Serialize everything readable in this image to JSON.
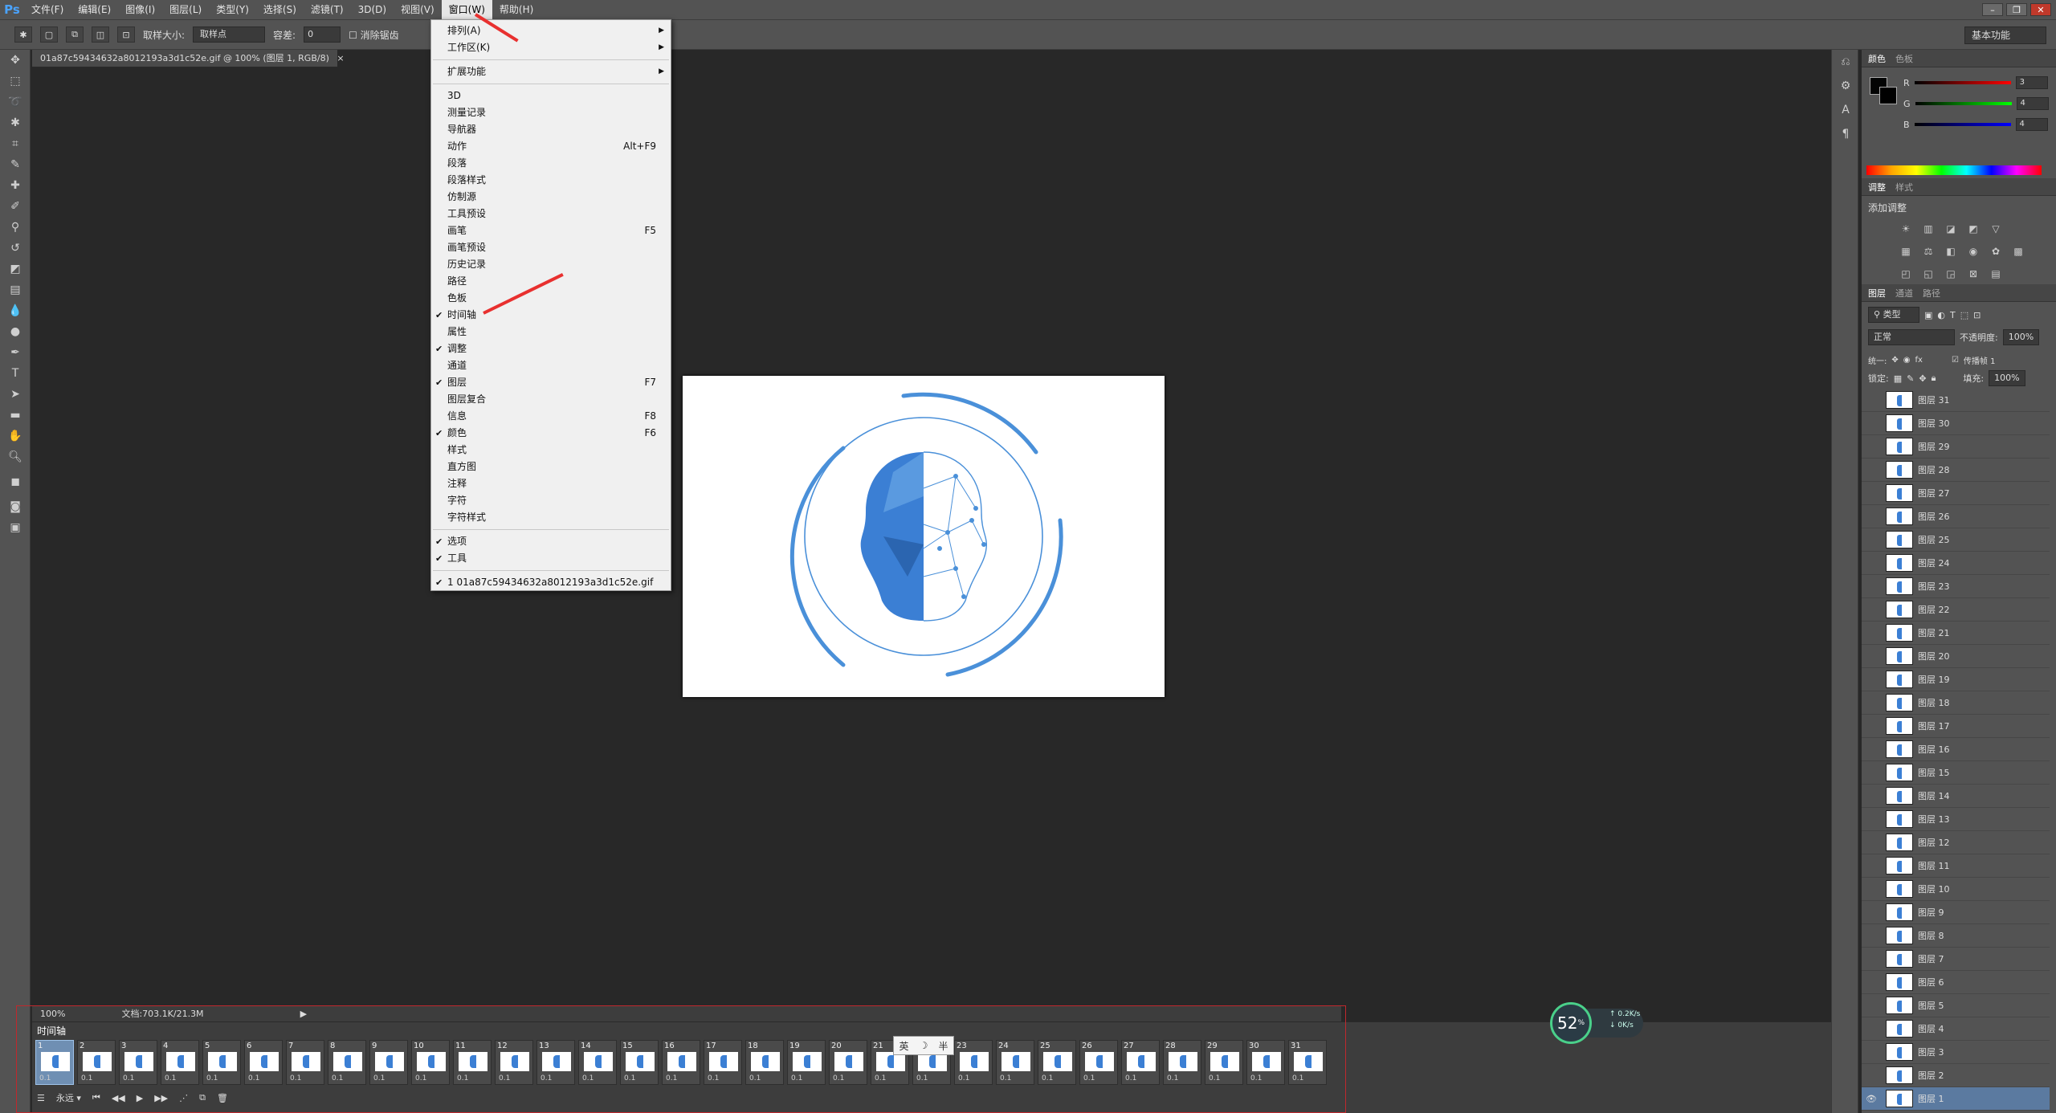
{
  "app": {
    "logo": "Ps"
  },
  "menubar": {
    "items": [
      "文件(F)",
      "编辑(E)",
      "图像(I)",
      "图层(L)",
      "类型(Y)",
      "选择(S)",
      "滤镜(T)",
      "3D(D)",
      "视图(V)",
      "窗口(W)",
      "帮助(H)"
    ],
    "active_index": 9
  },
  "optionsbar": {
    "sample_size_label": "取样大小:",
    "sample_size_value": "取样点",
    "tolerance_label": "容差:",
    "tolerance_value": "0",
    "antialias_label": "消除锯齿",
    "workspace": "基本功能"
  },
  "document": {
    "tab_title": "01a87c59434632a8012193a3d1c52e.gif @ 100% (图层 1, RGB/8)",
    "tab_close": "×"
  },
  "window_menu": {
    "groups": [
      [
        {
          "label": "排列(A)",
          "submenu": true
        },
        {
          "label": "工作区(K)",
          "submenu": true
        }
      ],
      [
        {
          "label": "扩展功能",
          "submenu": true
        }
      ],
      [
        {
          "label": "3D"
        },
        {
          "label": "测量记录"
        },
        {
          "label": "导航器"
        },
        {
          "label": "动作",
          "shortcut": "Alt+F9"
        },
        {
          "label": "段落"
        },
        {
          "label": "段落样式"
        },
        {
          "label": "仿制源"
        },
        {
          "label": "工具预设"
        },
        {
          "label": "画笔",
          "shortcut": "F5"
        },
        {
          "label": "画笔预设"
        },
        {
          "label": "历史记录"
        },
        {
          "label": "路径"
        },
        {
          "label": "色板"
        },
        {
          "label": "时间轴",
          "checked": true
        },
        {
          "label": "属性"
        },
        {
          "label": "调整",
          "checked": true
        },
        {
          "label": "通道"
        },
        {
          "label": "图层",
          "checked": true,
          "shortcut": "F7"
        },
        {
          "label": "图层复合"
        },
        {
          "label": "信息",
          "shortcut": "F8"
        },
        {
          "label": "颜色",
          "checked": true,
          "shortcut": "F6"
        },
        {
          "label": "样式"
        },
        {
          "label": "直方图"
        },
        {
          "label": "注释"
        },
        {
          "label": "字符"
        },
        {
          "label": "字符样式"
        }
      ],
      [
        {
          "label": "选项",
          "checked": true
        },
        {
          "label": "工具",
          "checked": true
        }
      ],
      [
        {
          "label": "1 01a87c59434632a8012193a3d1c52e.gif",
          "checked": true
        }
      ]
    ],
    "check_glyph": "✔",
    "arrow_glyph": "▶"
  },
  "status": {
    "zoom": "100%",
    "doc_size": "文档:703.1K/21.3M"
  },
  "timeline": {
    "tab": "时间轴",
    "frames": [
      "1",
      "2",
      "3",
      "4",
      "5",
      "6",
      "7",
      "8",
      "9",
      "10",
      "11",
      "12",
      "13",
      "14",
      "15",
      "16",
      "17",
      "18",
      "19",
      "20",
      "21",
      "22",
      "23",
      "24",
      "25",
      "26",
      "27",
      "28",
      "29",
      "30",
      "31"
    ],
    "frame_delay": "0.1",
    "selected_frame": 1,
    "loop": "永远"
  },
  "ime": {
    "lang": "英",
    "moon": "☽",
    "mode": "半"
  },
  "net_widget": {
    "percent": "52",
    "unit": "%",
    "up": "0.2K/s",
    "down": "0K/s"
  },
  "color_panel": {
    "tabs": [
      "颜色",
      "色板"
    ],
    "r_label": "R",
    "r_value": "3",
    "g_label": "G",
    "g_value": "4",
    "b_label": "B",
    "b_value": "4"
  },
  "adjust_panel": {
    "tabs": [
      "调整",
      "样式"
    ],
    "title": "添加调整"
  },
  "layers_panel": {
    "tabs": [
      "图层",
      "通道",
      "路径"
    ],
    "filter": "类型",
    "blend_mode": "正常",
    "opacity_label": "不透明度:",
    "opacity": "100%",
    "unify_label": "统一:",
    "propagate_label": "传播帧 1",
    "lock_label": "锁定:",
    "fill_label": "填充:",
    "fill": "100%",
    "layers": [
      "图层 31",
      "图层 30",
      "图层 29",
      "图层 28",
      "图层 27",
      "图层 26",
      "图层 25",
      "图层 24",
      "图层 23",
      "图层 22",
      "图层 21",
      "图层 20",
      "图层 19",
      "图层 18",
      "图层 17",
      "图层 16",
      "图层 15",
      "图层 14",
      "图层 13",
      "图层 12",
      "图层 11",
      "图层 10",
      "图层 9",
      "图层 8",
      "图层 7",
      "图层 6",
      "图层 5",
      "图层 4",
      "图层 3",
      "图层 2",
      "图层 1"
    ],
    "visible_layer": "图层 1"
  },
  "colors": {
    "accent": "#4a90d9",
    "annotation": "#e8302f",
    "menu_bg": "#f0f0f0"
  }
}
